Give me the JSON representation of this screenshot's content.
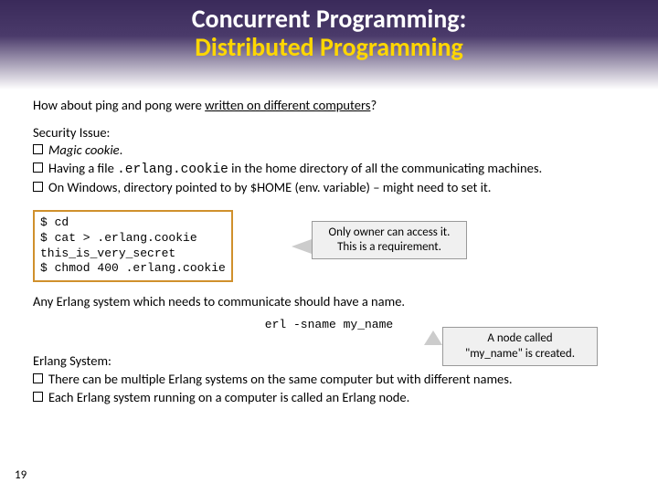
{
  "header": {
    "title_line1": "Concurrent Programming:",
    "title_line2": "Distributed Programming"
  },
  "question_prefix": "How about ping and pong were ",
  "question_underlined": "written  on different computers",
  "question_suffix": "?",
  "security": {
    "heading": "Security Issue:",
    "bullets": [
      {
        "prefix": "",
        "italic": "Magic cookie",
        "rest": "."
      },
      {
        "prefix": "Having a file ",
        "mono": ".erlang.cookie",
        "rest": " in the home directory of all the communicating machines."
      },
      {
        "prefix": "On Windows, directory pointed to by $HOME (env. variable) – might need to set it.",
        "mono": "",
        "rest": ""
      }
    ]
  },
  "terminal": {
    "lines": [
      "$ cd",
      "$ cat > .erlang.cookie",
      "this_is_very_secret",
      "$ chmod 400 .erlang.cookie"
    ],
    "callout_l1": "Only owner can access it.",
    "callout_l2": "This is a requirement."
  },
  "para2": "Any Erlang system which needs to communicate should have a name.",
  "node_cmd": "erl -sname my_name",
  "callout_node_l1": "A node called",
  "callout_node_l2": "\"my_name\" is created.",
  "erlang_system": {
    "heading": "Erlang System:",
    "bullets": [
      "There can be multiple Erlang systems on the same computer but with different names.",
      "Each Erlang system running on a computer is called an Erlang node."
    ]
  },
  "page_number": "19"
}
